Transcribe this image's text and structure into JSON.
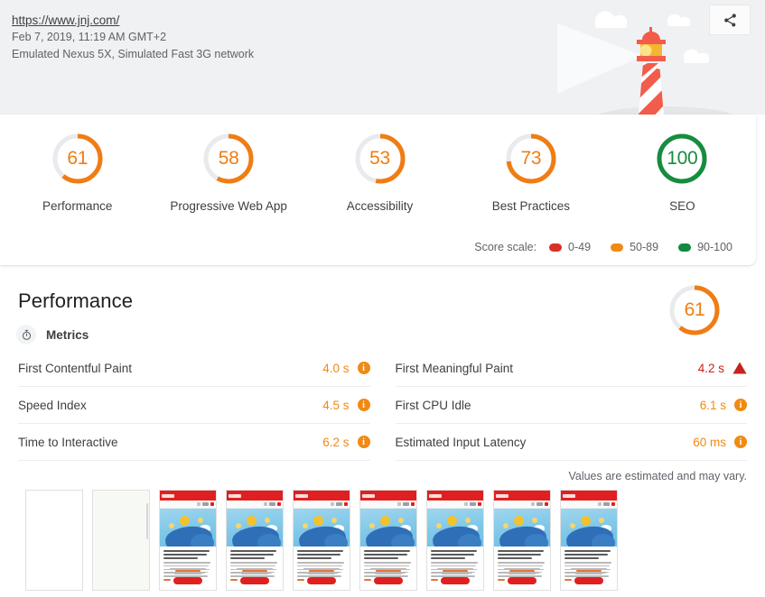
{
  "header": {
    "url": "https://www.jnj.com/",
    "timestamp": "Feb 7, 2019, 11:19 AM GMT+2",
    "environment": "Emulated Nexus 5X, Simulated Fast 3G network",
    "share_icon": "share-icon"
  },
  "colors": {
    "orange": "#ef7d14",
    "green": "#178c3f",
    "red": "#c7221f",
    "track": "#e8eaed",
    "header_bg": "#eff1f3"
  },
  "scores": [
    {
      "value": "61",
      "label": "Performance",
      "color": "#ef7d14",
      "pct": 61
    },
    {
      "value": "58",
      "label": "Progressive Web App",
      "color": "#ef7d14",
      "pct": 58
    },
    {
      "value": "53",
      "label": "Accessibility",
      "color": "#ef7d14",
      "pct": 53
    },
    {
      "value": "73",
      "label": "Best Practices",
      "color": "#ef7d14",
      "pct": 73
    },
    {
      "value": "100",
      "label": "SEO",
      "color": "#178c3f",
      "pct": 100
    }
  ],
  "score_scale": {
    "title": "Score scale:",
    "items": [
      {
        "range": "0-49",
        "color": "#d93025"
      },
      {
        "range": "50-89",
        "color": "#ef8a14"
      },
      {
        "range": "90-100",
        "color": "#128a3f"
      }
    ]
  },
  "performance": {
    "title": "Performance",
    "gauge_value": "61",
    "gauge_color": "#ef7d14",
    "gauge_pct": 61,
    "metrics_label": "Metrics",
    "metrics_icon": "stopwatch-icon",
    "left_metrics": [
      {
        "name": "First Contentful Paint",
        "value": "4.0 s",
        "badge": "info",
        "color": "#ef8a14"
      },
      {
        "name": "Speed Index",
        "value": "4.5 s",
        "badge": "info",
        "color": "#ef8a14"
      },
      {
        "name": "Time to Interactive",
        "value": "6.2 s",
        "badge": "info",
        "color": "#ef8a14"
      }
    ],
    "right_metrics": [
      {
        "name": "First Meaningful Paint",
        "value": "4.2 s",
        "badge": "warning",
        "color": "#c7221f"
      },
      {
        "name": "First CPU Idle",
        "value": "6.1 s",
        "badge": "info",
        "color": "#ef8a14"
      },
      {
        "name": "Estimated Input Latency",
        "value": "60 ms",
        "badge": "info",
        "color": "#ef8a14"
      }
    ],
    "estimate_note": "Values are estimated and may vary."
  },
  "filmstrip": {
    "frames": [
      {
        "state": "blank"
      },
      {
        "state": "offwhite"
      },
      {
        "state": "rendered"
      },
      {
        "state": "rendered"
      },
      {
        "state": "rendered"
      },
      {
        "state": "rendered"
      },
      {
        "state": "rendered"
      },
      {
        "state": "rendered"
      },
      {
        "state": "rendered"
      }
    ]
  }
}
